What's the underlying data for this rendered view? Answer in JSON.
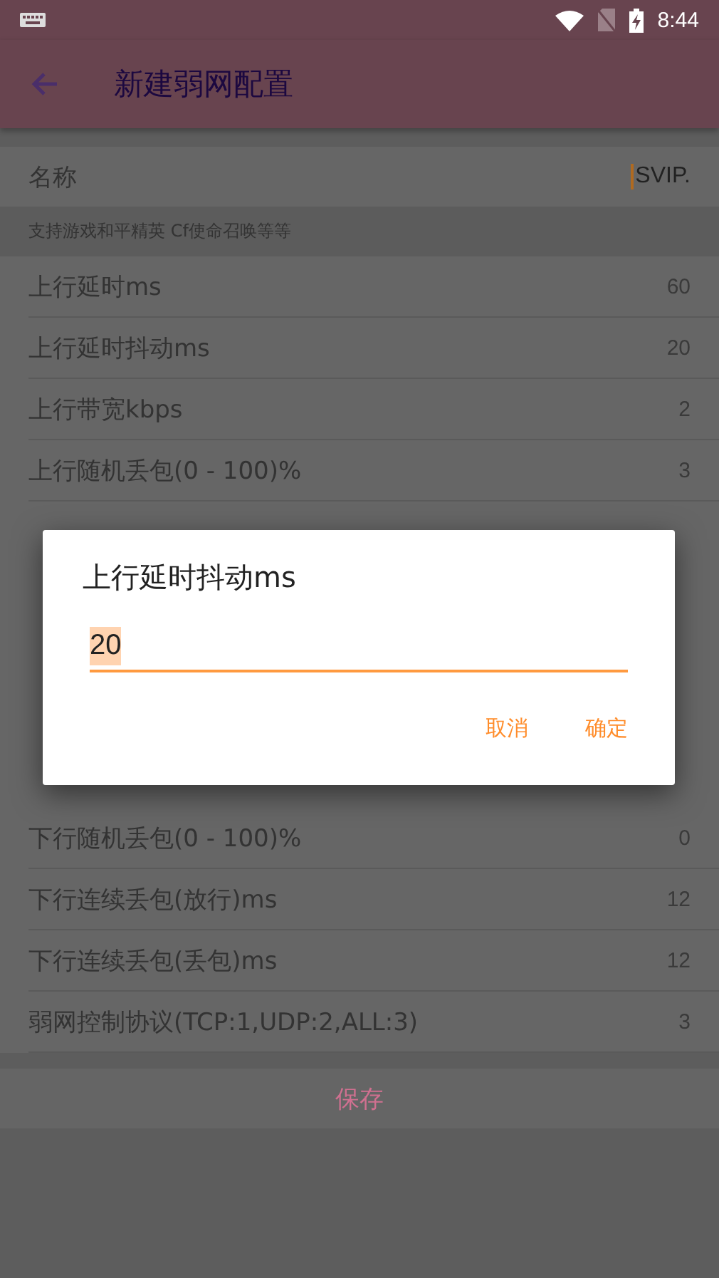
{
  "status_bar": {
    "time": "8:44"
  },
  "app_bar": {
    "title": "新建弱网配置"
  },
  "name_field": {
    "label": "名称",
    "value": "SVIP."
  },
  "hint": "支持游戏和平精英 Cf使命召唤等等",
  "settings": [
    {
      "label": "上行延时ms",
      "value": "60"
    },
    {
      "label": "上行延时抖动ms",
      "value": "20"
    },
    {
      "label": "上行带宽kbps",
      "value": "2"
    },
    {
      "label": "上行随机丢包(0 - 100)%",
      "value": "3"
    },
    {
      "label": "下行随机丢包(0 - 100)%",
      "value": "0"
    },
    {
      "label": "下行连续丢包(放行)ms",
      "value": "12"
    },
    {
      "label": "下行连续丢包(丢包)ms",
      "value": "12"
    },
    {
      "label": "弱网控制协议(TCP:1,UDP:2,ALL:3)",
      "value": "3"
    }
  ],
  "save_button": "保存",
  "dialog": {
    "title": "上行延时抖动ms",
    "value": "20",
    "buttons": [
      "取消",
      "确定"
    ]
  }
}
